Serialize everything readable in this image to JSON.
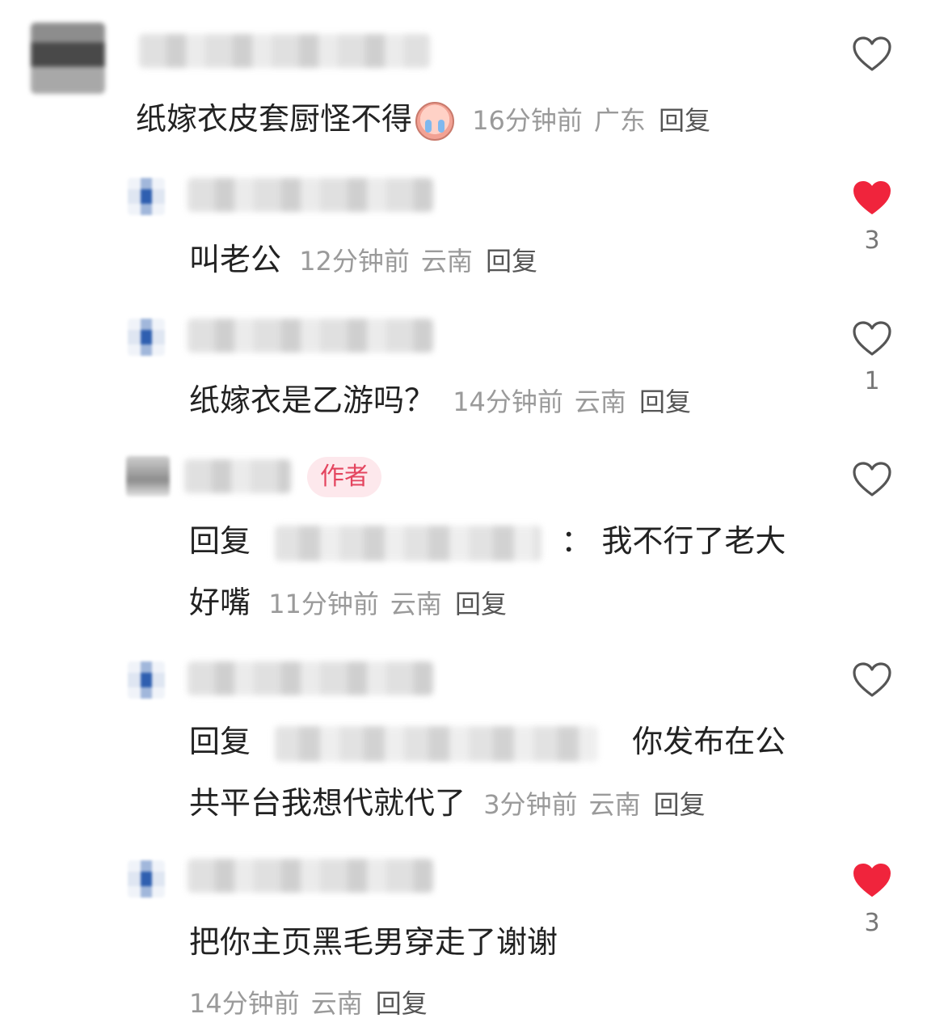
{
  "comments": [
    {
      "text": "纸嫁衣皮套厨怪不得",
      "emoji": "crying-face-emoji",
      "time": "16分钟前",
      "location": "广东",
      "reply": "回复"
    }
  ],
  "replies": [
    {
      "text": "叫老公",
      "time": "12分钟前",
      "location": "云南",
      "reply": "回复",
      "likes": "3",
      "liked": true
    },
    {
      "text": "纸嫁衣是乙游吗？",
      "time": "14分钟前",
      "location": "云南",
      "reply": "回复",
      "likes": "1",
      "liked": false
    },
    {
      "badge": "作者",
      "prefix": "回复",
      "colon": "：",
      "text_line1": "我不行了老大",
      "text_line2": "好嘴",
      "time": "11分钟前",
      "location": "云南",
      "reply": "回复",
      "liked": false
    },
    {
      "prefix": "回复",
      "text_line1": "你发布在公",
      "text_line2": "共平台我想代就代了",
      "time": "3分钟前",
      "location": "云南",
      "reply": "回复",
      "liked": false
    },
    {
      "text": "把你主页黑毛男穿走了谢谢",
      "time": "14分钟前",
      "location": "云南",
      "reply": "回复",
      "likes": "3",
      "liked": true
    }
  ],
  "colors": {
    "liked_heart": "#f0243c",
    "unliked_heart": "#555555",
    "author_badge_bg": "#fde8ec",
    "author_badge_text": "#e4455f"
  }
}
